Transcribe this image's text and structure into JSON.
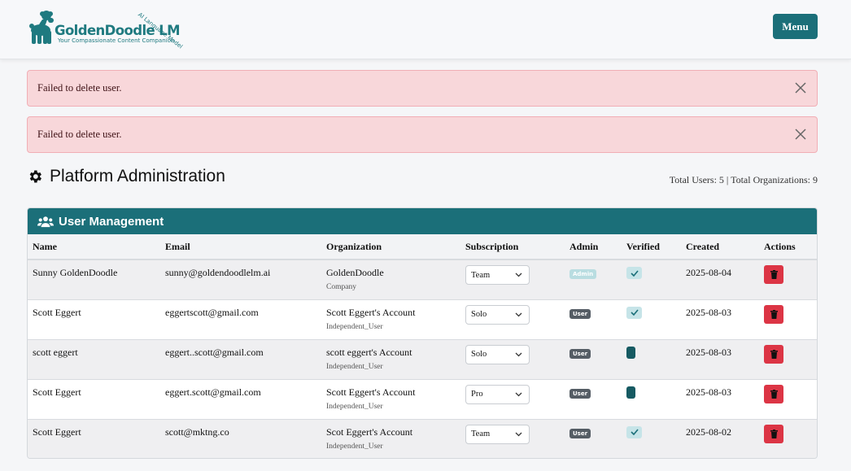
{
  "header": {
    "brand": "GoldenDoodle LM",
    "tagline": "Your Compassionate Content Companion",
    "arc_text": "AI Language Model",
    "menu_label": "Menu"
  },
  "alerts": [
    {
      "message": "Failed to delete user."
    },
    {
      "message": "Failed to delete user."
    }
  ],
  "page": {
    "title": "Platform Administration",
    "totals": "Total Users: 5 | Total Organizations: 9"
  },
  "user_management": {
    "title": "User Management",
    "columns": {
      "name": "Name",
      "email": "Email",
      "organization": "Organization",
      "subscription": "Subscription",
      "admin": "Admin",
      "verified": "Verified",
      "created": "Created",
      "actions": "Actions"
    },
    "rows": [
      {
        "name": "Sunny GoldenDoodle",
        "email": "sunny@goldendoodlelm.ai",
        "org": "GoldenDoodle",
        "org_type": "Company",
        "subscription": "Team",
        "admin_badge": "Admin",
        "is_admin": true,
        "verified": true,
        "created": "2025-08-04"
      },
      {
        "name": "Scott Eggert",
        "email": "eggertscott@gmail.com",
        "org": "Scott Eggert's Account",
        "org_type": "Independent_User",
        "subscription": "Solo",
        "admin_badge": "User",
        "is_admin": false,
        "verified": true,
        "created": "2025-08-03"
      },
      {
        "name": "scott eggert",
        "email": "eggert..scott@gmail.com",
        "org": "scott eggert's Account",
        "org_type": "Independent_User",
        "subscription": "Solo",
        "admin_badge": "User",
        "is_admin": false,
        "verified": false,
        "created": "2025-08-03"
      },
      {
        "name": "Scott Eggert",
        "email": "eggert.scott@gmail.com",
        "org": "Scott Eggert's Account",
        "org_type": "Independent_User",
        "subscription": "Pro",
        "admin_badge": "User",
        "is_admin": false,
        "verified": false,
        "created": "2025-08-03"
      },
      {
        "name": "Scott Eggert",
        "email": "scott@mktng.co",
        "org": "Scot Eggert's Account",
        "org_type": "Independent_User",
        "subscription": "Team",
        "admin_badge": "User",
        "is_admin": false,
        "verified": true,
        "created": "2025-08-02"
      }
    ]
  },
  "colors": {
    "brand": "#1b6f79",
    "alert_bg": "#f8d7da",
    "danger": "#dc3545",
    "badge_user": "#555d65",
    "badge_admin": "#b9dde1"
  }
}
